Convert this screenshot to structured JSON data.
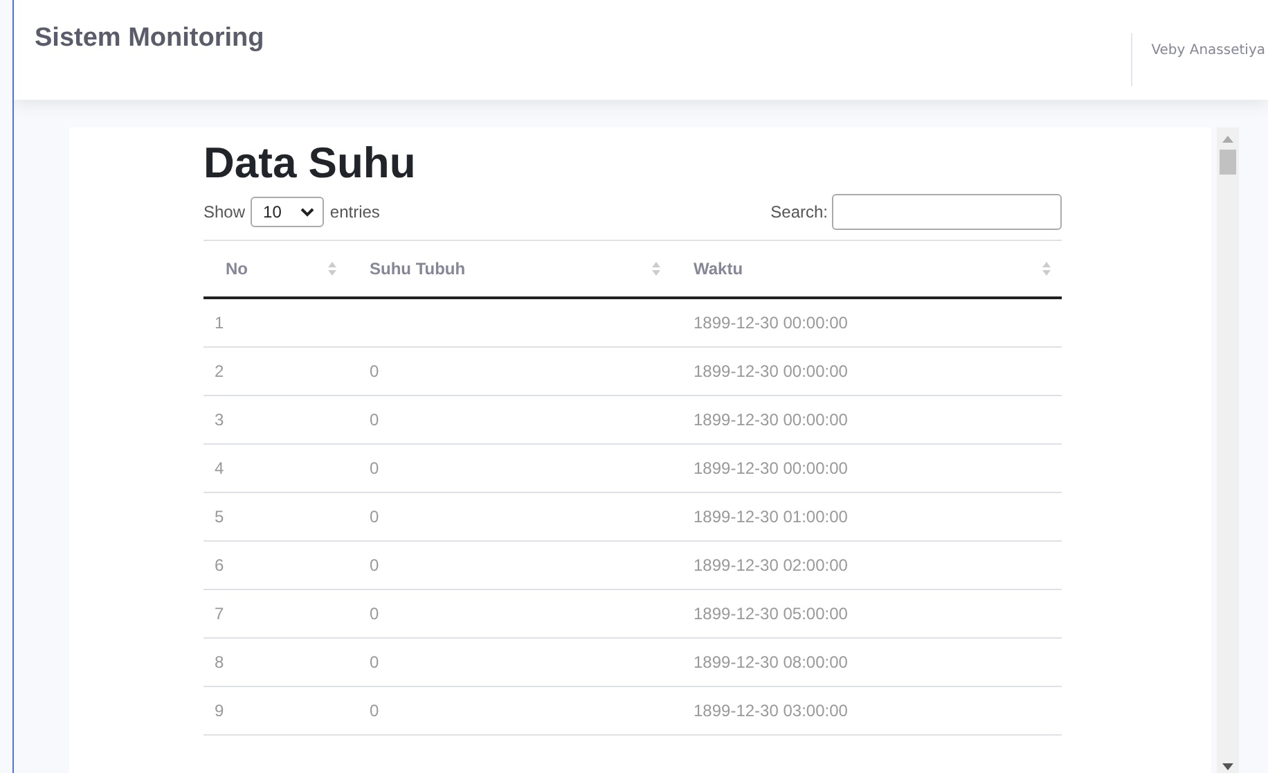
{
  "topbar": {
    "title": "Sistem Monitoring",
    "user": "Veby Anassetiya"
  },
  "content": {
    "heading": "Data Suhu",
    "length": {
      "prefix": "Show",
      "value": "10",
      "suffix": "entries"
    },
    "search": {
      "label": "Search:"
    },
    "table": {
      "columns": [
        "No",
        "Suhu Tubuh",
        "Waktu"
      ],
      "rows": [
        {
          "no": "1",
          "waktu": "1899-12-30 00:00:00"
        },
        {
          "no": "2",
          "suhu": "0",
          "waktu": "1899-12-30 00:00:00"
        },
        {
          "no": "3",
          "suhu": "0",
          "waktu": "1899-12-30 00:00:00"
        },
        {
          "no": "4",
          "suhu": "0",
          "waktu": "1899-12-30 00:00:00"
        },
        {
          "no": "5",
          "suhu": "0",
          "waktu": "1899-12-30 01:00:00"
        },
        {
          "no": "6",
          "suhu": "0",
          "waktu": "1899-12-30 02:00:00"
        },
        {
          "no": "7",
          "suhu": "0",
          "waktu": "1899-12-30 05:00:00"
        },
        {
          "no": "8",
          "suhu": "0",
          "waktu": "1899-12-30 08:00:00"
        },
        {
          "no": "9",
          "suhu": "0",
          "waktu": "1899-12-30 03:00:00"
        }
      ]
    }
  }
}
